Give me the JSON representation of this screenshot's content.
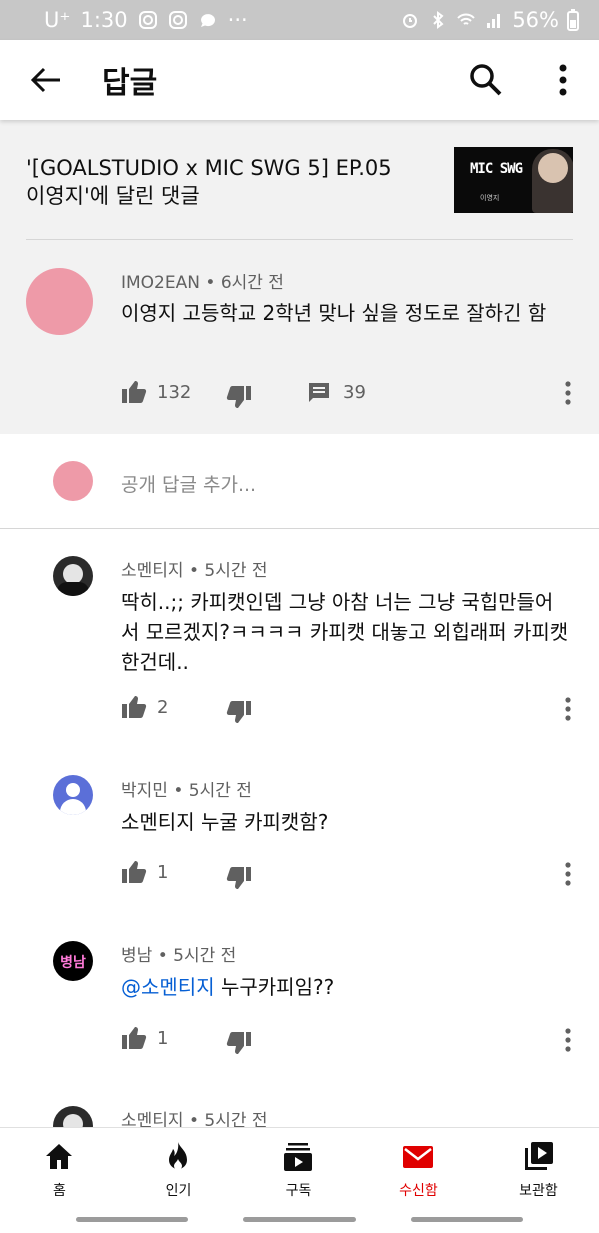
{
  "status_bar": {
    "carrier": "U⁺",
    "time": "1:30",
    "dots": "···",
    "battery": "56%"
  },
  "app_bar": {
    "title": "답글"
  },
  "video": {
    "title_line1": "'[GOALSTUDIO x MIC SWG 5] EP.05",
    "title_line2": "이영지'에 달린 댓글",
    "thumb_text": "MIC SWG",
    "thumb_subtext": "이영지"
  },
  "parent_comment": {
    "author": "IMO2EAN",
    "time": "6시간 전",
    "text": "이영지 고등학교 2학년 맞나 싶을 정도로 잘하긴 함",
    "likes": "132",
    "replies": "39"
  },
  "add_reply": {
    "placeholder": "공개 답글 추가..."
  },
  "replies": [
    {
      "author": "소멘티지",
      "time": "5시간 전",
      "text": "딱히..;; 카피캣인뎁 그냥 아참 너는 그냥 국힙만들어서 모르겠지?ㅋㅋㅋㅋ 카피캣 대놓고 외힙래퍼 카피캣한건데..",
      "likes": "2"
    },
    {
      "author": "박지민",
      "time": "5시간 전",
      "text": "소멘티지 누굴 카피캣함?",
      "likes": "1"
    },
    {
      "author": "병남",
      "time": "5시간 전",
      "mention": "@소멘티지",
      "text": " 누구카피임??",
      "likes": "1",
      "avatar_text": "병남"
    },
    {
      "author": "소멘티지",
      "time": "5시간 전"
    }
  ],
  "meta_separator": "•",
  "bottom_nav": [
    {
      "label": "홈",
      "icon": "home-icon"
    },
    {
      "label": "인기",
      "icon": "flame-icon"
    },
    {
      "label": "구독",
      "icon": "subscriptions-icon"
    },
    {
      "label": "수신함",
      "icon": "inbox-icon",
      "active": true
    },
    {
      "label": "보관함",
      "icon": "library-icon"
    }
  ],
  "colors": {
    "accent": "#e00000",
    "mention": "#065fd4",
    "parent_bg": "#f2f2f2",
    "avatar_pink": "#ee9aa8",
    "avatar_blue": "#5b6fd8"
  }
}
